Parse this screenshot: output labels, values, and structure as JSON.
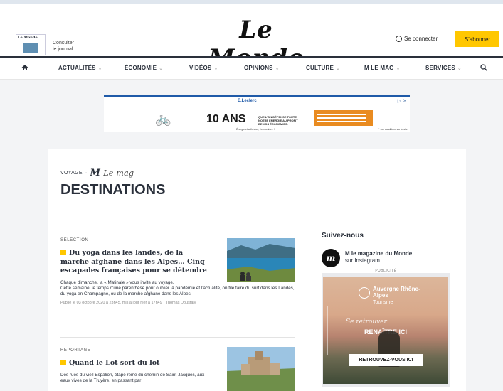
{
  "header": {
    "logo": "Le Monde",
    "paper_thumb_title": "Le Monde",
    "consult_line1": "Consulter",
    "consult_line2": "le journal",
    "login": "Se connecter",
    "subscribe": "S'abonner"
  },
  "nav": {
    "items": [
      {
        "label": "ACTUALITÉS"
      },
      {
        "label": "ÉCONOMIE"
      },
      {
        "label": "VIDÉOS"
      },
      {
        "label": "OPINIONS"
      },
      {
        "label": "CULTURE"
      },
      {
        "label": "M LE MAG"
      },
      {
        "label": "SERVICES"
      }
    ]
  },
  "ad": {
    "brand": "E.Leclerc",
    "title": "10 ANS",
    "small": "QUE L'ON DÉPENSE TOUTE NOTRE ÉNERGIE AU PROFIT DE VOS ÉCONOMIES.",
    "bottom": "Énergie et adhésion, économisez !",
    "legal": "* voir conditions sur le site",
    "close": "▷ ✕"
  },
  "page": {
    "rubric_voyage": "VOYAGE",
    "rubric_sep": "·",
    "rubric_m": "M",
    "rubric_lemag": "Le mag",
    "title": "DESTINATIONS"
  },
  "articles": [
    {
      "kicker": "SÉLECTION",
      "title": "Du yoga dans les landes, de la marche afghane dans les Alpes… Cinq escapades françaises pour se détendre",
      "desc_line1": "Chaque dimanche, la « Matinale » vous invite au voyage.",
      "desc_line2": "Cette semaine, le temps d'une parenthèse pour oublier la pandémie et l'actualité, on file faire du surf dans les Landes, du yoga en Champagne, ou de la marche afghane dans les Alpes.",
      "meta": "Publié le 03 octobre 2020 à 23h45, mis à jour hier à 17h49  ·  Thomas Doustaly"
    },
    {
      "kicker": "REPORTAGE",
      "title": "Quand le Lot sort du lot",
      "desc_line1": "Des rues du vieil Espalion, étape reine du chemin de Saint-Jacques, aux eaux vives de la Truyère, en passant par",
      "desc_line2": "",
      "meta": ""
    }
  ],
  "sidebar": {
    "follow": "Suivez-nous",
    "insta_name": "M le magazine du Monde",
    "insta_sub": "sur Instagram",
    "pub_label": "PUBLICITÉ",
    "region": "Auvergne Rhône-Alpes",
    "region_sub": "Tourisme",
    "script": "Se retrouver",
    "rena": "RENAÎTRE ICI",
    "cta": "RETROUVEZ-VOUS ICI"
  }
}
